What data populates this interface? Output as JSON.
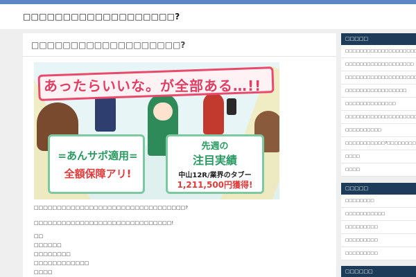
{
  "site": {
    "title": "□□□□□□□□□□□□□□□□□□□?"
  },
  "post": {
    "title": "□□□□□□□□□□□□□□□□□□□?",
    "banner": {
      "headline": "あったらいいな。が全部ある…!!",
      "left_box_line1": "=あんサポ適用=",
      "left_box_line2": "全額保障アリ!",
      "right_box_line1": "先週の",
      "right_box_line2": "注目実績",
      "right_box_line3": "中山12R/業界のタブー",
      "right_box_line4": "1,211,500円獲得!"
    },
    "paragraphs": [
      "□□□□□□□□□□□□□□□□□□□□□□□□□□□□□□□□□?",
      "□□□□□□□□□□□□□□□□□□□□□□□□□□□□□□!"
    ],
    "list": [
      "□□",
      "□□□□□□",
      "□□□□□□□□",
      "□□□□□□□□□□□□",
      "□□□□"
    ]
  },
  "sidebar": {
    "widgets": [
      {
        "heading": "□□□□□",
        "items": [
          "□□□□□□□□□□□□□□□□□□□□□",
          "□□□□□□□□□□□□□□□□□□□",
          "□□□□□□□□□□□□□□□□□□□□□□□□□□□□□□□□□□□",
          "□□□□□□□□□□□□□□□□□",
          "□□□□□□□□□□□□□□",
          "□□□□□□□□□□□□□□□□□□□□□□?□□□□",
          "□□□□□□□□□□",
          "□□□□□□□□□□□?□□□□□□□□",
          "□□□□",
          "□□□□"
        ]
      },
      {
        "heading": "□□□□□",
        "items": [
          "□□□□□□□□",
          "□□□□□□□□□□□",
          "□□□□□□□□□",
          "□□□□□□□□□",
          "□□□□□□□□□"
        ]
      },
      {
        "heading": "□□□□□□",
        "items": []
      }
    ]
  }
}
